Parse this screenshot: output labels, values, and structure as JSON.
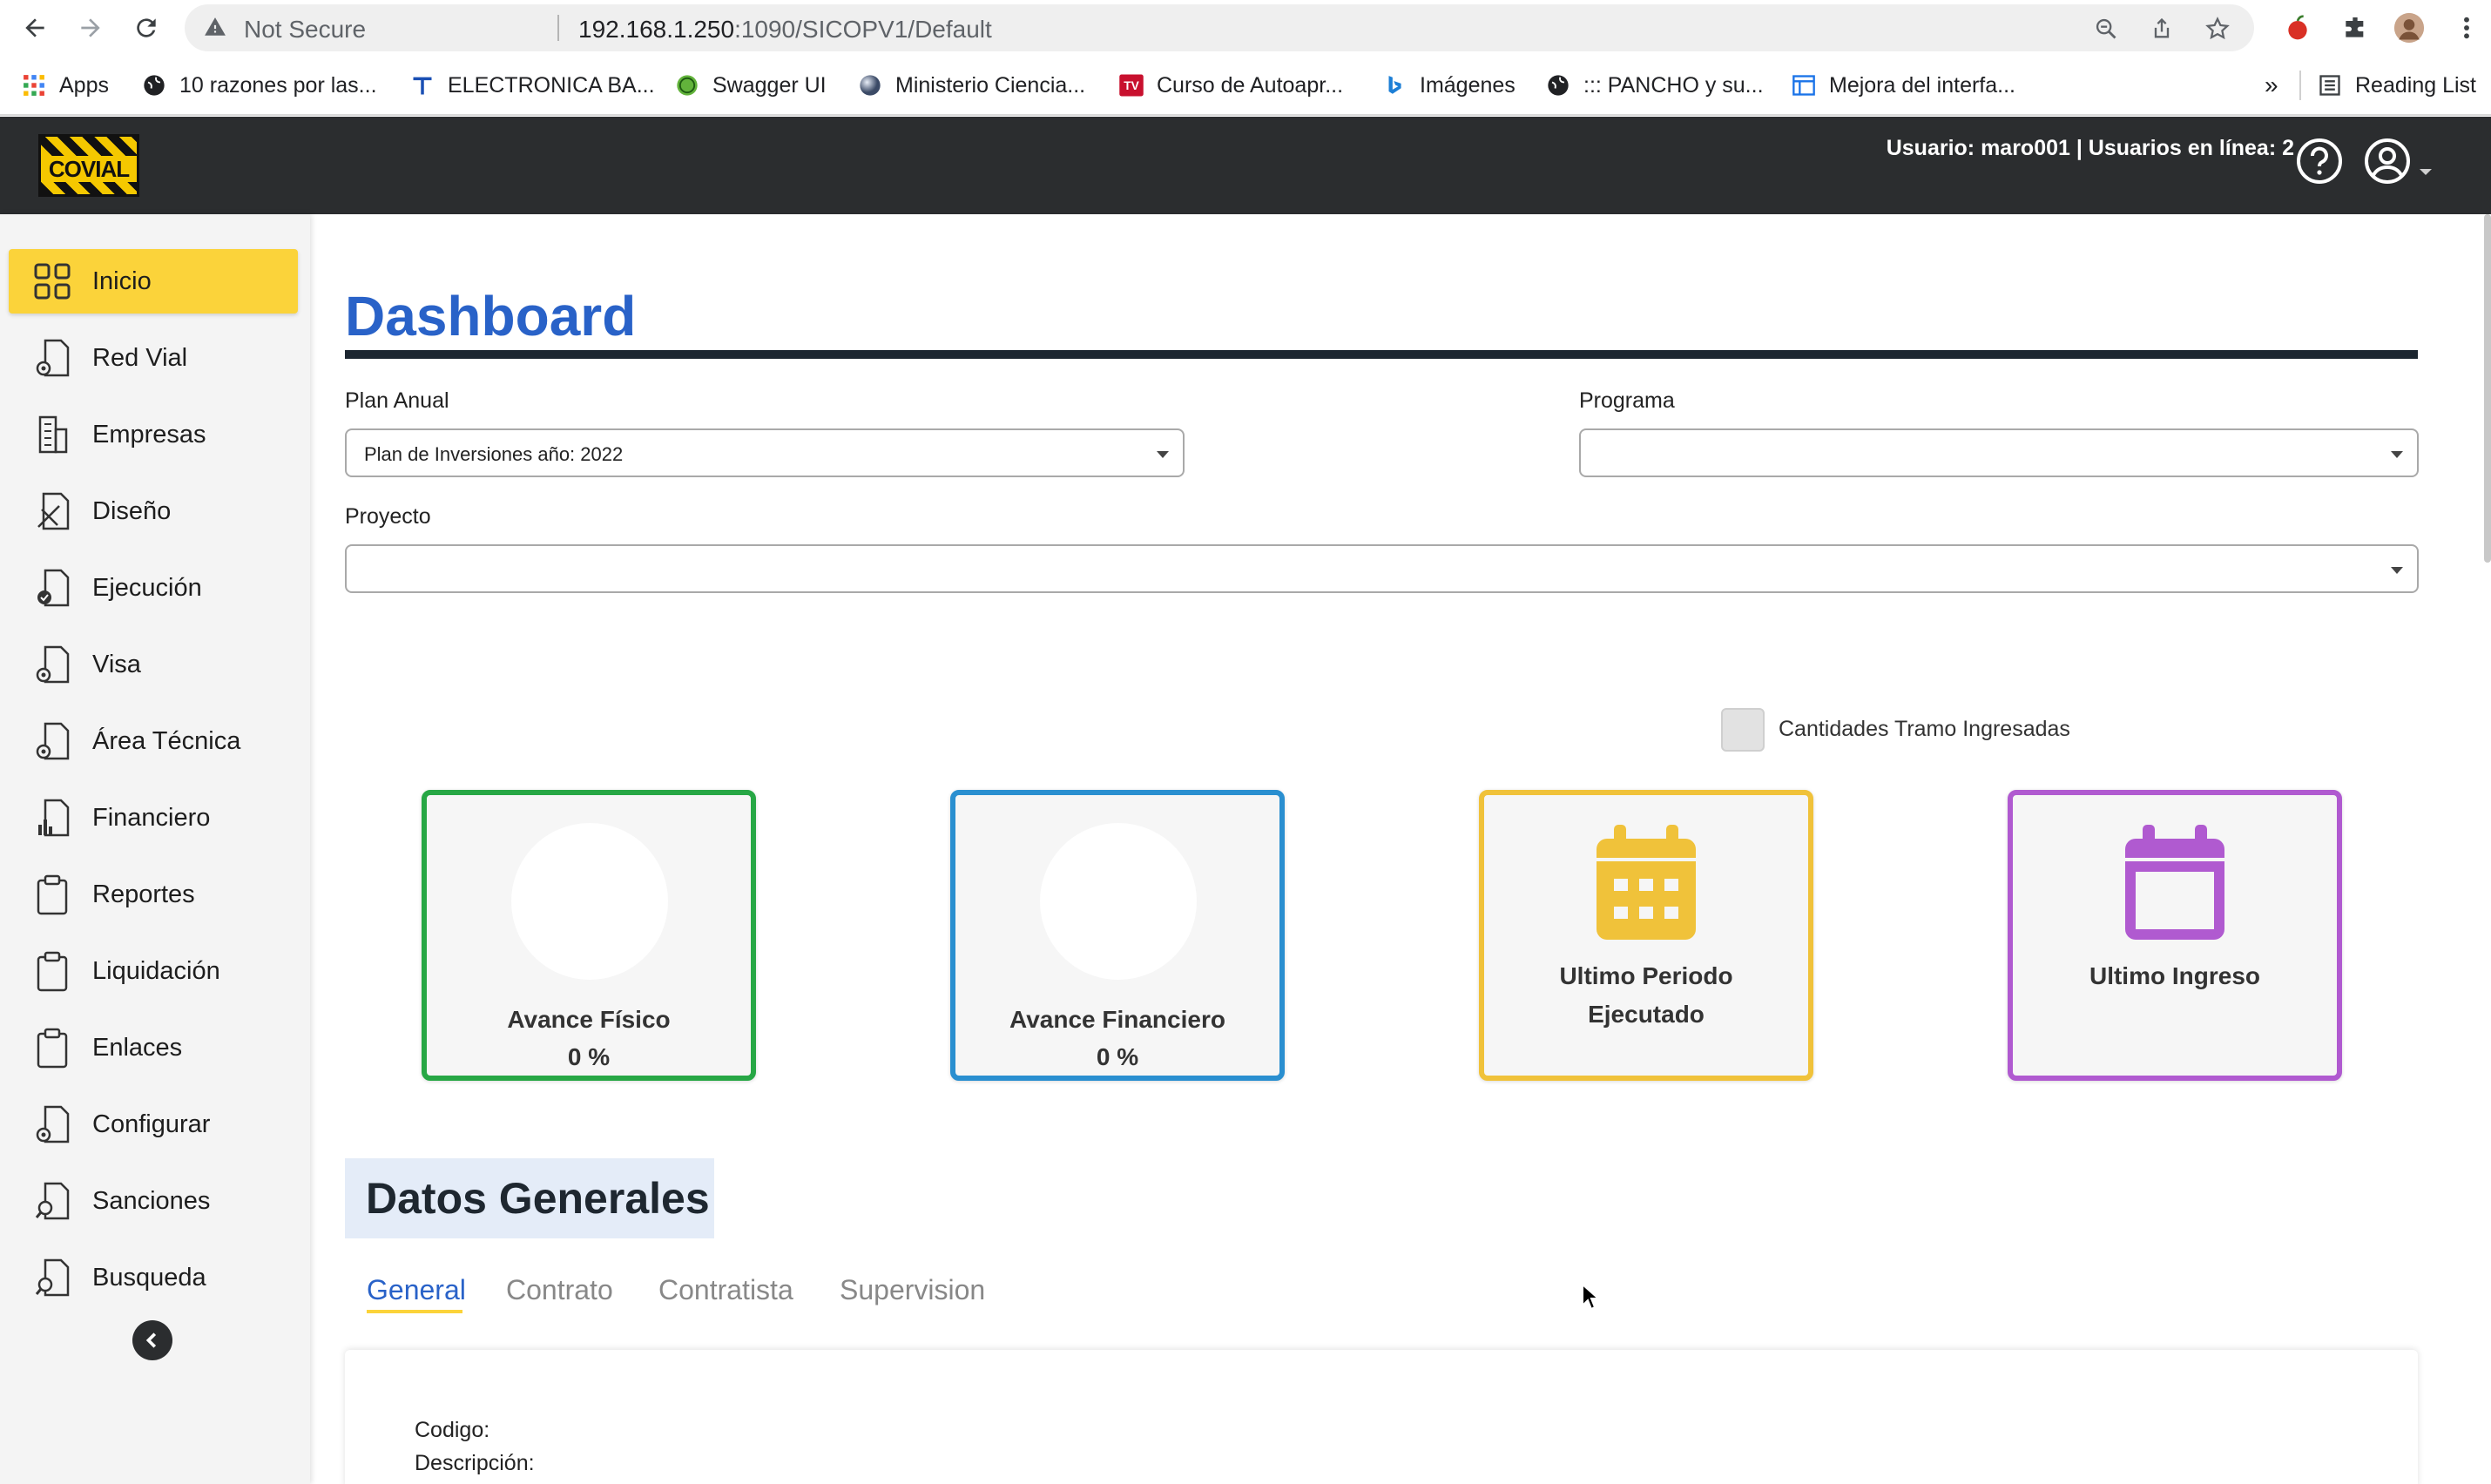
{
  "browser": {
    "not_secure": "Not Secure",
    "url_host": "192.168.1.250",
    "url_path": ":1090/SICOPV1/Default",
    "bookmarks": [
      {
        "label": "Apps",
        "icon": "apps-grid-icon"
      },
      {
        "label": "10 razones por las...",
        "icon": "globe-icon"
      },
      {
        "label": "ELECTRONICA BA...",
        "icon": "t-logo-icon"
      },
      {
        "label": "Swagger UI",
        "icon": "swagger-icon"
      },
      {
        "label": "Ministerio Ciencia...",
        "icon": "sphere-icon"
      },
      {
        "label": "Curso de Autoapr...",
        "icon": "tv-icon"
      },
      {
        "label": "Imágenes",
        "icon": "bing-icon"
      },
      {
        "label": "::: PANCHO y su...",
        "icon": "globe-icon"
      },
      {
        "label": "Mejora del interfa...",
        "icon": "window-icon"
      }
    ],
    "overflow": "»",
    "reading_list": "Reading List"
  },
  "header": {
    "logo_text": "COVIAL",
    "user_info": "Usuario: maro001 | Usuarios en línea: 2"
  },
  "sidebar": {
    "items": [
      {
        "label": "Inicio",
        "icon": "grid-icon",
        "active": true
      },
      {
        "label": "Red Vial",
        "icon": "doc-gear-icon"
      },
      {
        "label": "Empresas",
        "icon": "building-icon"
      },
      {
        "label": "Diseño",
        "icon": "doc-pencil-icon"
      },
      {
        "label": "Ejecución",
        "icon": "doc-check-icon"
      },
      {
        "label": "Visa",
        "icon": "doc-gear-icon"
      },
      {
        "label": "Área Técnica",
        "icon": "doc-gear-icon"
      },
      {
        "label": "Financiero",
        "icon": "doc-chart-icon"
      },
      {
        "label": "Reportes",
        "icon": "clipboard-icon"
      },
      {
        "label": "Liquidación",
        "icon": "clipboard-icon"
      },
      {
        "label": "Enlaces",
        "icon": "clipboard-icon"
      },
      {
        "label": "Configurar",
        "icon": "doc-gear-icon"
      },
      {
        "label": "Sanciones",
        "icon": "doc-search-icon"
      },
      {
        "label": "Busqueda",
        "icon": "doc-search-icon"
      }
    ]
  },
  "main": {
    "title": "Dashboard",
    "plan_label": "Plan Anual",
    "plan_value": "Plan de Inversiones año: 2022",
    "programa_label": "Programa",
    "programa_value": "",
    "proyecto_label": "Proyecto",
    "proyecto_value": "",
    "checkbox_label": "Cantidades Tramo Ingresadas",
    "cards": [
      {
        "title": "Avance Físico",
        "value": "0 %",
        "color": "#27a745"
      },
      {
        "title": "Avance Financiero",
        "value": "0 %",
        "color": "#2a8fd0"
      },
      {
        "title": "Ultimo Periodo Ejecutado",
        "color": "#f0c23a"
      },
      {
        "title": "Ultimo Ingreso",
        "color": "#b05ad0"
      }
    ],
    "section_title": "Datos Generales",
    "tabs": [
      "General",
      "Contrato",
      "Contratista",
      "Supervision"
    ],
    "codigo_label": "Codigo:",
    "descripcion_label": "Descripción:"
  }
}
